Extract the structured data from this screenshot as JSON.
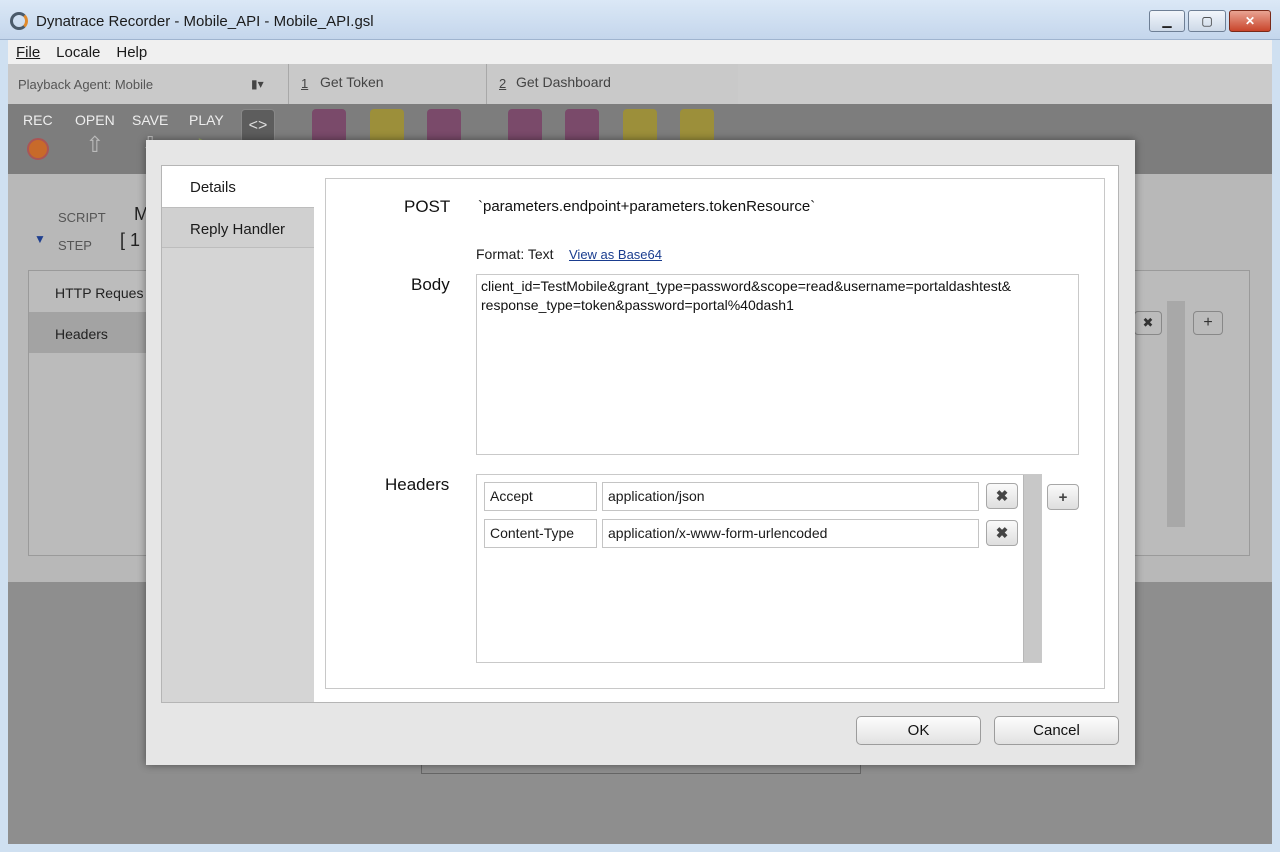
{
  "window": {
    "title": "Dynatrace Recorder - Mobile_API - Mobile_API.gsl"
  },
  "menu": {
    "items": [
      "File",
      "Locale",
      "Help"
    ]
  },
  "background": {
    "agent_label": "Playback Agent: Mobile",
    "tabs": [
      {
        "num": "1",
        "name": "Get Token"
      },
      {
        "num": "2",
        "name": "Get Dashboard"
      }
    ],
    "toolbar": {
      "rec": "REC",
      "open": "OPEN",
      "save": "SAVE",
      "play": "PLAY"
    },
    "script_label": "SCRIPT",
    "script_value": "M",
    "step_label": "STEP",
    "step_value": "[ 1",
    "left_tabs": [
      "HTTP Reques",
      "Headers"
    ]
  },
  "dialog": {
    "tabs": {
      "details": "Details",
      "reply_handler": "Reply Handler"
    },
    "method": "POST",
    "url": "`parameters.endpoint+parameters.tokenResource`",
    "format_label": "Format: Text",
    "base64_link": "View as Base64",
    "body_label": "Body",
    "body_text": "client_id=TestMobile&grant_type=password&scope=read&username=portaldashtest&\nresponse_type=token&password=portal%40dash1",
    "headers_label": "Headers",
    "headers": [
      {
        "name": "Accept",
        "value": "application/json"
      },
      {
        "name": "Content-Type",
        "value": "application/x-www-form-urlencoded"
      }
    ],
    "ok_label": "OK",
    "cancel_label": "Cancel"
  }
}
